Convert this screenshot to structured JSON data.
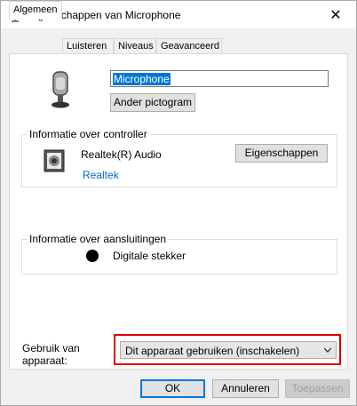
{
  "window": {
    "title": "Eigenschappen van Microphone",
    "close_glyph": "✕"
  },
  "tabs": [
    {
      "label": "Algemeen",
      "active": true
    },
    {
      "label": "Luisteren",
      "active": false
    },
    {
      "label": "Niveaus",
      "active": false
    },
    {
      "label": "Geavanceerd",
      "active": false
    }
  ],
  "general": {
    "device_name_value": "Microphone",
    "change_icon_label": "Ander pictogram",
    "controller_group_label": "Informatie over controller",
    "controller_name": "Realtek(R) Audio",
    "controller_vendor_link": "Realtek",
    "properties_button_label": "Eigenschappen",
    "jack_group_label": "Informatie over aansluitingen",
    "jack_name": "Digitale stekker",
    "usage_label_line1": "Gebruik van",
    "usage_label_line2": "apparaat:",
    "usage_selected": "Dit apparaat gebruiken (inschakelen)"
  },
  "footer": {
    "ok_label": "OK",
    "cancel_label": "Annuleren",
    "apply_label": "Toepassen"
  },
  "colors": {
    "accent": "#0078d7",
    "highlight_box": "#e00000",
    "link": "#0066cc"
  }
}
